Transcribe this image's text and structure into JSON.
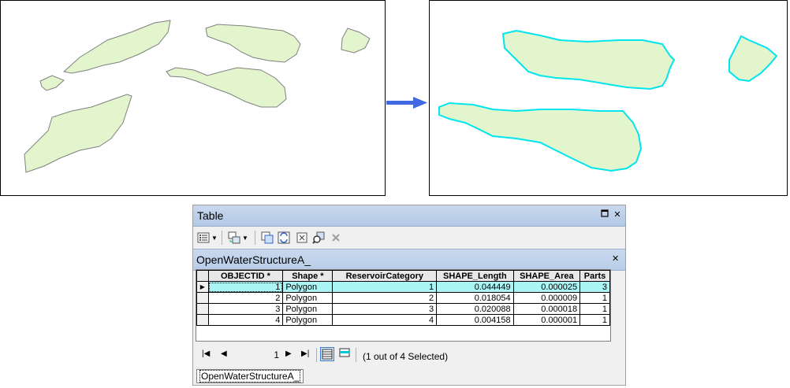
{
  "table_window": {
    "title": "Table",
    "layer_tab": "OpenWaterStructureA_",
    "bottom_tab": "OpenWaterStructureA_",
    "columns": [
      "OBJECTID *",
      "Shape *",
      "ReservoirCategory",
      "SHAPE_Length",
      "SHAPE_Area",
      "Parts"
    ],
    "rows": [
      {
        "objectid": "1",
        "shape": "Polygon",
        "category": "1",
        "length": "0.044449",
        "area": "0.000025",
        "parts": "3",
        "selected": true
      },
      {
        "objectid": "2",
        "shape": "Polygon",
        "category": "2",
        "length": "0.018054",
        "area": "0.000009",
        "parts": "1",
        "selected": false
      },
      {
        "objectid": "3",
        "shape": "Polygon",
        "category": "3",
        "length": "0.020088",
        "area": "0.000018",
        "parts": "1",
        "selected": false
      },
      {
        "objectid": "4",
        "shape": "Polygon",
        "category": "4",
        "length": "0.004158",
        "area": "0.000001",
        "parts": "1",
        "selected": false
      }
    ],
    "record_number": "1",
    "selection_status": "(1 out of 4 Selected)"
  },
  "colors": {
    "polygon_fill": "#e2f5cc",
    "polygon_stroke": "#808080",
    "selection_outline": "#00e5ee",
    "selected_row": "#aaf5f6",
    "arrow": "#4169e1"
  },
  "icons": {
    "arrow": "right-arrow-icon",
    "table_options": "table-options-icon",
    "related_tables": "related-tables-icon",
    "select_by_attributes": "select-by-attributes-icon",
    "switch_selection": "switch-selection-icon",
    "clear_selection": "clear-selection-icon",
    "zoom_to_selected": "zoom-to-selected-icon",
    "delete_selected": "delete-selected-icon"
  }
}
